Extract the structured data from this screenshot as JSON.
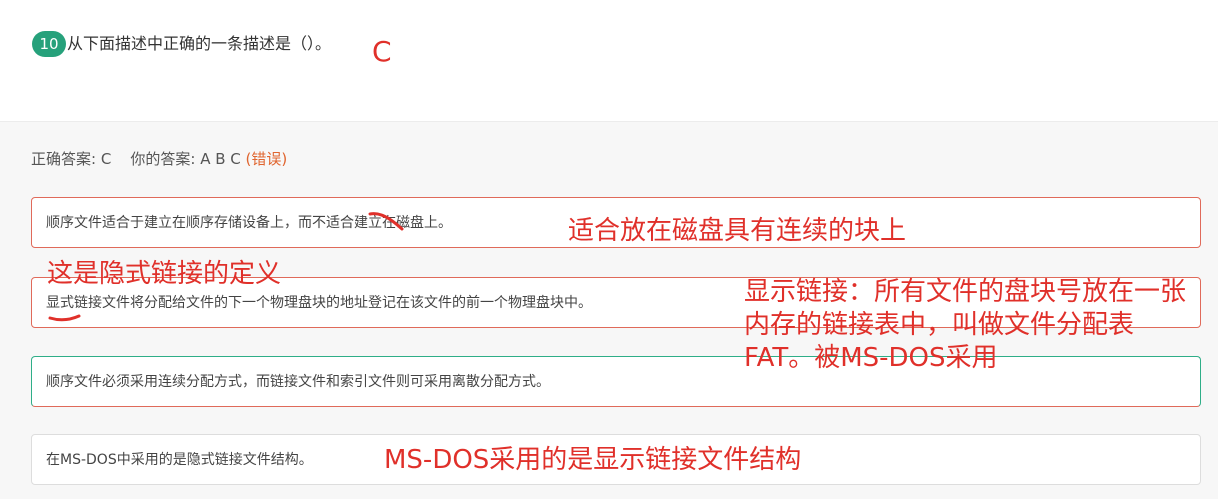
{
  "question": {
    "number": "10",
    "text": "从下面描述中正确的一条描述是（）。",
    "annotation": "C"
  },
  "answer": {
    "correct_label": "正确答案: C",
    "yours_label": "你的答案: A B C",
    "status": "(错误)"
  },
  "options": [
    {
      "text": "顺序文件适合于建立在顺序存储设备上，而不适合建立在磁盘上。",
      "state": "wrong"
    },
    {
      "text": "显式链接文件将分配给文件的下一个物理盘块的地址登记在该文件的前一个物理盘块中。",
      "state": "wrong"
    },
    {
      "text": "顺序文件必须采用连续分配方式，而链接文件和索引文件则可采用离散分配方式。",
      "state": "correct"
    },
    {
      "text": "在MS-DOS中采用的是隐式链接文件结构。",
      "state": "neutral"
    }
  ],
  "annotations": {
    "opt1_note": "适合放在磁盘具有连续的块上",
    "opt2_above": "这是隐式链接的定义",
    "opt2_right": "显示链接：所有文件的盘块号放在一张内存的链接表中，叫做文件分配表FAT。被MS-DOS采用",
    "opt4_note": "MS-DOS采用的是显示链接文件结构"
  },
  "colors": {
    "accent": "#26a17b",
    "annotation_red": "#e0302a",
    "wrong_border": "#e06a5a",
    "correct_border": "#2fae88"
  }
}
